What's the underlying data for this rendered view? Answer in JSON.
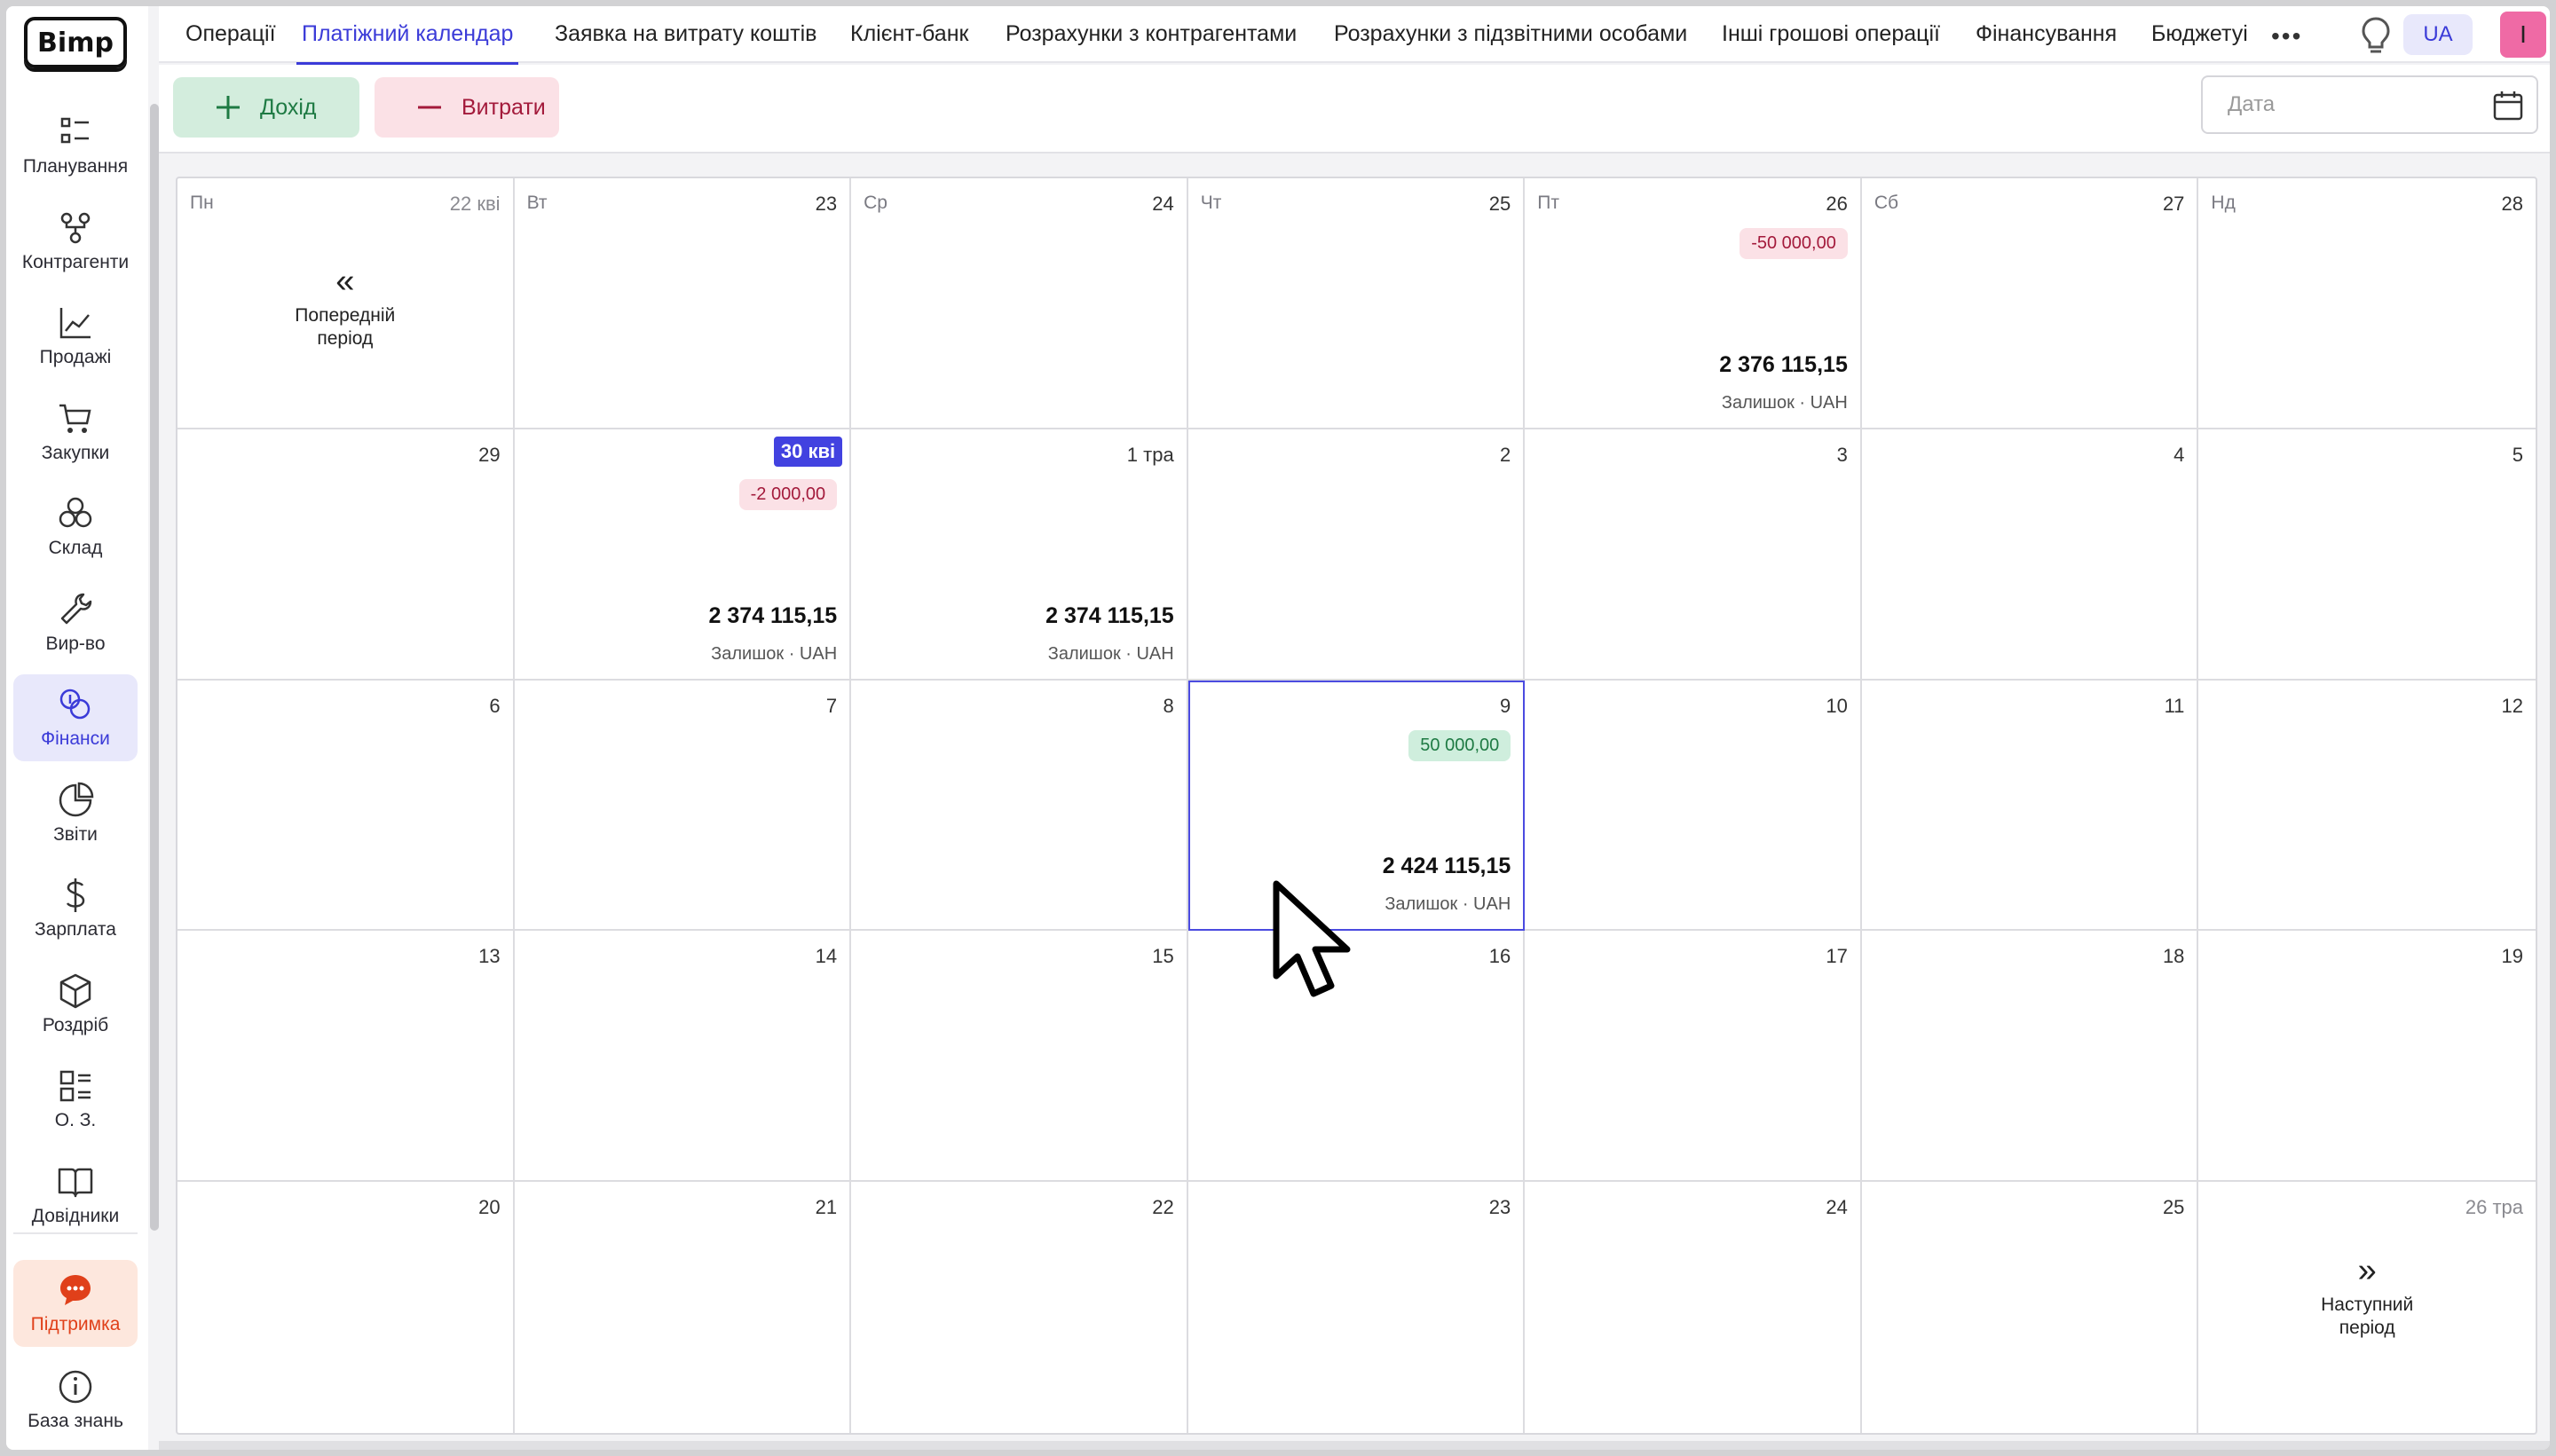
{
  "brand": "Bimp",
  "sidebar": {
    "items": [
      {
        "label": "Планування",
        "icon": "planning-icon"
      },
      {
        "label": "Контрагенти",
        "icon": "contractors-icon"
      },
      {
        "label": "Продажі",
        "icon": "sales-chart-icon"
      },
      {
        "label": "Закупки",
        "icon": "cart-icon"
      },
      {
        "label": "Склад",
        "icon": "warehouse-icon"
      },
      {
        "label": "Вир-во",
        "icon": "wrench-icon"
      },
      {
        "label": "Фінанси",
        "icon": "finance-coins-icon",
        "active": true
      },
      {
        "label": "Звіти",
        "icon": "pie-chart-icon"
      },
      {
        "label": "Зарплата",
        "icon": "dollar-icon"
      },
      {
        "label": "Роздріб",
        "icon": "box-icon"
      },
      {
        "label": "О. З.",
        "icon": "assets-list-icon"
      },
      {
        "label": "Довідники",
        "icon": "book-icon"
      }
    ],
    "support": {
      "label": "Підтримка",
      "icon": "chat-icon"
    },
    "knowledge": {
      "label": "База знань",
      "icon": "info-icon"
    }
  },
  "tabs": [
    {
      "label": "Операції"
    },
    {
      "label": "Платіжний календар",
      "active": true
    },
    {
      "label": "Заявка на витрату коштів"
    },
    {
      "label": "Клієнт-банк"
    },
    {
      "label": "Розрахунки з контрагентами"
    },
    {
      "label": "Розрахунки з підзвітними особами"
    },
    {
      "label": "Інші грошові операції"
    },
    {
      "label": "Фінансування"
    },
    {
      "label": "Бюджетуі"
    }
  ],
  "header": {
    "more": "•••",
    "lang": "UA",
    "avatar": "I"
  },
  "actions": {
    "income": "Дохід",
    "expense": "Витрати",
    "date_placeholder": "Дата"
  },
  "colors": {
    "accent": "#3b3bd8",
    "income": "#1e7a43",
    "expense": "#a31a3b",
    "support": "#e0401a"
  },
  "calendar": {
    "weekdays": [
      "Пн",
      "Вт",
      "Ср",
      "Чт",
      "Пт",
      "Сб",
      "Нд"
    ],
    "prev_period": "Попередній період",
    "next_period": "Наступний період",
    "balance_label": "Залишок  ·  UAH",
    "days": [
      {
        "day": "22 кві",
        "muted": true
      },
      {
        "day": "23"
      },
      {
        "day": "24"
      },
      {
        "day": "25"
      },
      {
        "day": "26",
        "amount": "-50 000,00",
        "type": "neg",
        "balance": "2 376 115,15"
      },
      {
        "day": "27"
      },
      {
        "day": "28"
      },
      {
        "day": "29"
      },
      {
        "day": "30 кві",
        "today": true,
        "amount": "-2 000,00",
        "type": "neg",
        "balance": "2 374 115,15"
      },
      {
        "day": "1 тра",
        "balance": "2 374 115,15"
      },
      {
        "day": "2"
      },
      {
        "day": "3"
      },
      {
        "day": "4"
      },
      {
        "day": "5"
      },
      {
        "day": "6"
      },
      {
        "day": "7"
      },
      {
        "day": "8"
      },
      {
        "day": "9",
        "amount": "50 000,00",
        "type": "pos",
        "balance": "2 424 115,15",
        "selected": true
      },
      {
        "day": "10"
      },
      {
        "day": "11"
      },
      {
        "day": "12"
      },
      {
        "day": "13"
      },
      {
        "day": "14"
      },
      {
        "day": "15"
      },
      {
        "day": "16"
      },
      {
        "day": "17"
      },
      {
        "day": "18"
      },
      {
        "day": "19"
      },
      {
        "day": "20"
      },
      {
        "day": "21"
      },
      {
        "day": "22"
      },
      {
        "day": "23"
      },
      {
        "day": "24"
      },
      {
        "day": "25"
      },
      {
        "day": "26 тра",
        "muted": true
      }
    ]
  }
}
